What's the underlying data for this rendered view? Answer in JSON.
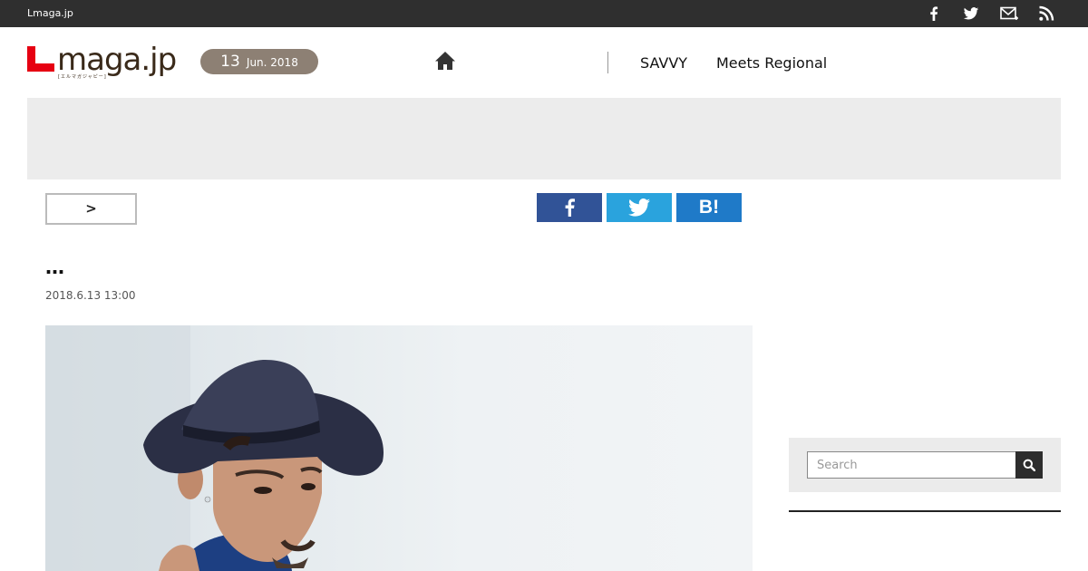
{
  "topbar": {
    "site_name": "Lmaga.jp",
    "icons": [
      "facebook-icon",
      "twitter-icon",
      "mail-icon",
      "rss-icon"
    ]
  },
  "header": {
    "logo_text": "maga.jp",
    "logo_sub": "[エルマガジャピー]",
    "date": {
      "day": "13",
      "month_year": "Jun. 2018"
    },
    "nav": [
      "SAVVY",
      "Meets Regional"
    ]
  },
  "breadcrumb": {
    "label": ">"
  },
  "share": {
    "hatena_label": "B!"
  },
  "article": {
    "title": "…",
    "published": "2018.6.13 13:00"
  },
  "sidebar": {
    "search_placeholder": "Search"
  },
  "colors": {
    "topbar": "#2f2f2f",
    "date_pill": "#8d8074",
    "logo_red": "#e60012",
    "facebook": "#315397",
    "twitter": "#2aa3dd",
    "hatena": "#1f7ac8"
  }
}
